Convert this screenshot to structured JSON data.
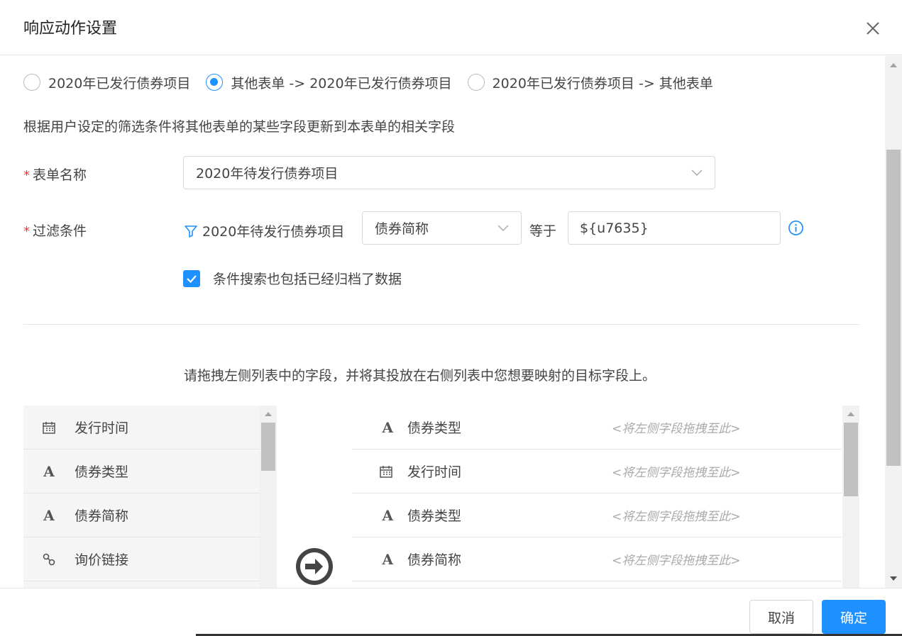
{
  "dialog": {
    "title": "响应动作设置"
  },
  "radios": [
    {
      "label": "2020年已发行债券项目",
      "checked": false
    },
    {
      "label": "其他表单 -> 2020年已发行债券项目",
      "checked": true
    },
    {
      "label": "2020年已发行债券项目 -> 其他表单",
      "checked": false
    }
  ],
  "description": "根据用户设定的筛选条件将其他表单的某些字段更新到本表单的相关字段",
  "form_name": {
    "required_mark": "*",
    "label": "表单名称",
    "value": "2020年待发行债券项目"
  },
  "filter": {
    "required_mark": "*",
    "label": "过滤条件",
    "source": "2020年待发行债券项目",
    "field": "债券简称",
    "operator": "等于",
    "value": "${u7635}"
  },
  "archive_checkbox": {
    "label": "条件搜索也包括已经归档了数据",
    "checked": true
  },
  "hint": "请拖拽左侧列表中的字段，并将其投放在右侧列表中您想要映射的目标字段上。",
  "left_fields": [
    {
      "icon": "calendar-icon",
      "label": "发行时间"
    },
    {
      "icon": "text-a-icon",
      "label": "债券类型"
    },
    {
      "icon": "text-a-icon",
      "label": "债券简称"
    },
    {
      "icon": "link-icon",
      "label": "询价链接"
    }
  ],
  "right_fields": [
    {
      "icon": "text-a-icon",
      "label": "债券类型",
      "placeholder": "<将左侧字段拖拽至此>"
    },
    {
      "icon": "calendar-icon",
      "label": "发行时间",
      "placeholder": "<将左侧字段拖拽至此>"
    },
    {
      "icon": "text-a-icon",
      "label": "债券类型",
      "placeholder": "<将左侧字段拖拽至此>"
    },
    {
      "icon": "text-a-icon",
      "label": "债券简称",
      "placeholder": "<将左侧字段拖拽至此>"
    }
  ],
  "buttons": {
    "cancel": "取消",
    "ok": "确定"
  },
  "colors": {
    "accent": "#1e90ff",
    "required": "#e53935"
  }
}
